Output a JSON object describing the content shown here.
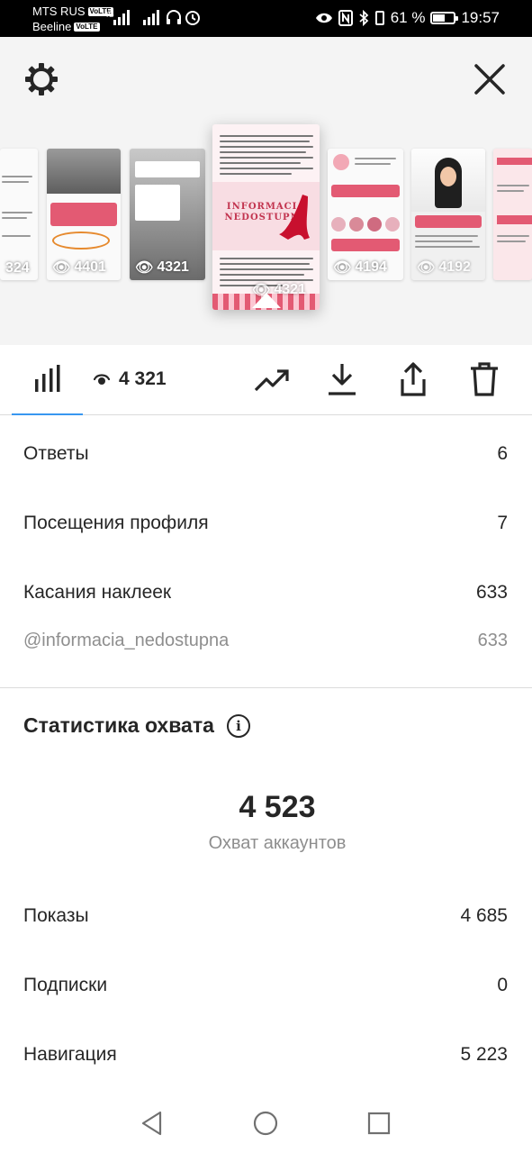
{
  "status_bar": {
    "carrier1": "MTS RUS",
    "carrier2": "Beeline",
    "volte": "VoLTE",
    "net": "4G",
    "battery": "61 %",
    "battery_level": 0.61,
    "time": "19:57"
  },
  "stories": {
    "views_far_left": "324",
    "views_left2": "4401",
    "views_left1": "4321",
    "views_current": "4321",
    "views_right1": "4194",
    "views_right2": "4192",
    "main_brand": "INFORMACIA\nNEDOSTUPNA"
  },
  "toolbar": {
    "views_count": "4 321"
  },
  "interactions": [
    {
      "label": "Ответы",
      "value": "6"
    },
    {
      "label": "Посещения профиля",
      "value": "7"
    },
    {
      "label": "Касания наклеек",
      "value": "633"
    }
  ],
  "sticker_row": {
    "label": "@informacia_nedostupna",
    "value": "633"
  },
  "reach": {
    "title": "Статистика охвата",
    "accounts_reached": "4 523",
    "accounts_reached_label": "Охват аккаунтов",
    "rows": [
      {
        "label": "Показы",
        "value": "4 685"
      },
      {
        "label": "Подписки",
        "value": "0"
      },
      {
        "label": "Навигация",
        "value": "5 223"
      }
    ]
  },
  "colors": {
    "accent_blue": "#3897f0",
    "brand_pink": "#e35a73",
    "text": "#262626",
    "secondary": "#8e8e8e"
  }
}
